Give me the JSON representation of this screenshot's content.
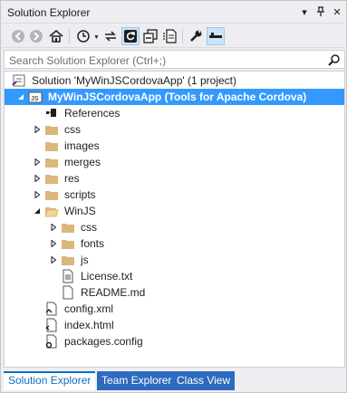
{
  "window": {
    "title": "Solution Explorer",
    "dropdown_glyph": "▾",
    "pin_glyph": "⊣",
    "close_glyph": "✕"
  },
  "search": {
    "placeholder": "Search Solution Explorer (Ctrl+;)"
  },
  "tree": [
    {
      "label": "Solution 'MyWinJSCordovaApp' (1 project)",
      "icon": "solution-icon",
      "depth": 0,
      "expander": "none"
    },
    {
      "label": "MyWinJSCordovaApp (Tools for Apache Cordova)",
      "icon": "js-project-icon",
      "depth": 0,
      "expander": "expanded",
      "selected": true
    },
    {
      "label": "References",
      "icon": "references-icon",
      "depth": 1,
      "expander": "none"
    },
    {
      "label": "css",
      "icon": "folder-icon",
      "depth": 1,
      "expander": "collapsed"
    },
    {
      "label": "images",
      "icon": "folder-icon",
      "depth": 1,
      "expander": "none"
    },
    {
      "label": "merges",
      "icon": "folder-icon",
      "depth": 1,
      "expander": "collapsed"
    },
    {
      "label": "res",
      "icon": "folder-icon",
      "depth": 1,
      "expander": "collapsed"
    },
    {
      "label": "scripts",
      "icon": "folder-icon",
      "depth": 1,
      "expander": "collapsed"
    },
    {
      "label": "WinJS",
      "icon": "folder-open-icon",
      "depth": 1,
      "expander": "expanded"
    },
    {
      "label": "css",
      "icon": "folder-icon",
      "depth": 2,
      "expander": "collapsed"
    },
    {
      "label": "fonts",
      "icon": "folder-icon",
      "depth": 2,
      "expander": "collapsed"
    },
    {
      "label": "js",
      "icon": "folder-icon",
      "depth": 2,
      "expander": "collapsed"
    },
    {
      "label": "License.txt",
      "icon": "text-file-icon",
      "depth": 2,
      "expander": "none"
    },
    {
      "label": "README.md",
      "icon": "file-icon",
      "depth": 2,
      "expander": "none"
    },
    {
      "label": "config.xml",
      "icon": "xml-file-icon",
      "depth": 1,
      "expander": "none"
    },
    {
      "label": "index.html",
      "icon": "html-file-icon",
      "depth": 1,
      "expander": "none"
    },
    {
      "label": "packages.config",
      "icon": "config-file-icon",
      "depth": 1,
      "expander": "none"
    }
  ],
  "tabs": [
    {
      "label": "Solution Explorer",
      "active": true
    },
    {
      "label": "Team Explorer",
      "active": false
    },
    {
      "label": "Class View",
      "active": false
    }
  ],
  "colors": {
    "selection": "#3399ff",
    "folder": "#dcb67a",
    "accent": "#0e70c0"
  }
}
